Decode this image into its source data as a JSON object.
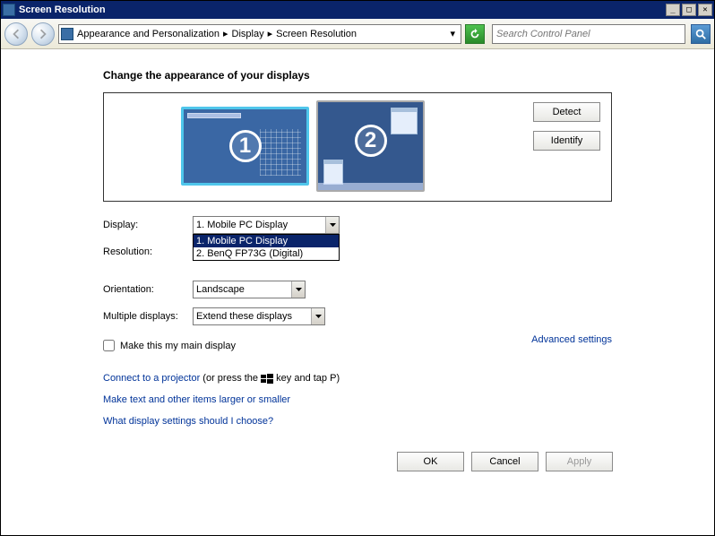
{
  "window": {
    "title": "Screen Resolution"
  },
  "breadcrumbs": {
    "item1": "Appearance and Personalization",
    "item2": "Display",
    "item3": "Screen Resolution"
  },
  "search": {
    "placeholder": "Search Control Panel"
  },
  "page": {
    "heading": "Change the appearance of your displays",
    "monitor1_num": "1",
    "monitor2_num": "2"
  },
  "buttons": {
    "detect": "Detect",
    "identify": "Identify",
    "ok": "OK",
    "cancel": "Cancel",
    "apply": "Apply"
  },
  "labels": {
    "display": "Display:",
    "resolution": "Resolution:",
    "orientation": "Orientation:",
    "multiple": "Multiple displays:"
  },
  "dropdowns": {
    "display_value": "1. Mobile PC Display",
    "display_opt1": "1. Mobile PC Display",
    "display_opt2": "2. BenQ FP73G (Digital)",
    "resolution_value": "",
    "orientation_value": "Landscape",
    "multiple_value": "Extend these displays"
  },
  "checks": {
    "main_display": "Make this my main display"
  },
  "links": {
    "advanced": "Advanced settings",
    "projector": "Connect to a projector",
    "projector_suffix1": " (or press the ",
    "projector_suffix2": " key and tap P)",
    "textsize": "Make text and other items larger or smaller",
    "which": "What display settings should I choose?"
  }
}
